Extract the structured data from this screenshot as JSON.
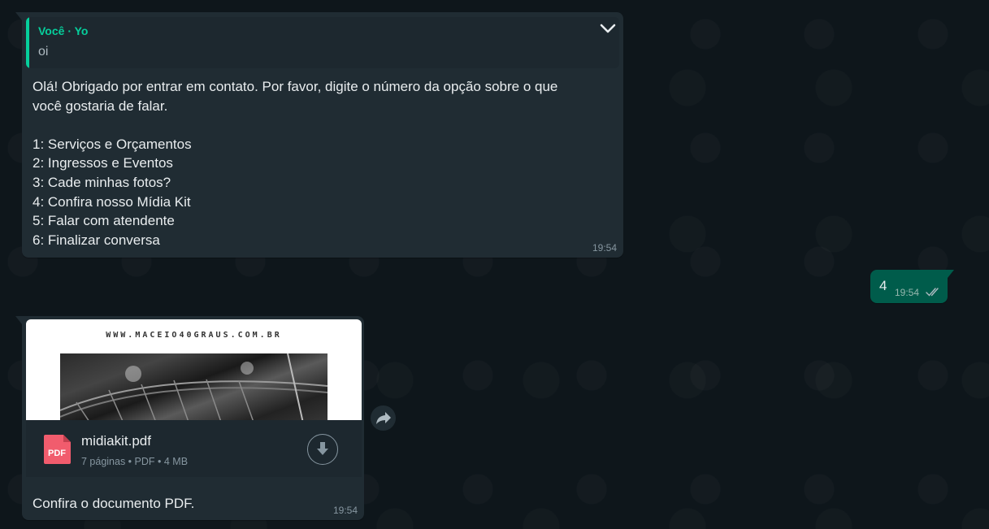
{
  "messages": {
    "greeting": {
      "quote_author": "Você · Yo",
      "quote_text": "oi",
      "body": "Olá! Obrigado por entrar em contato. Por favor, digite o número da opção sobre o que\nvocê gostaria de falar.\n\n1: Serviços e Orçamentos\n2: Ingressos e Eventos\n3: Cade minhas fotos?\n4: Confira nosso Mídia Kit\n5: Falar com atendente\n6: Finalizar conversa",
      "time": "19:54",
      "menu_icon": "chevron-down-icon"
    },
    "reply": {
      "text": "4",
      "time": "19:54",
      "status_icon": "double-check-icon"
    },
    "document": {
      "preview_url_text": "WWW.MACEIO40GRAUS.COM.BR",
      "file_name": "midiakit.pdf",
      "file_type_label": "PDF",
      "meta": "7 páginas • PDF • 4 MB",
      "caption": "Confira o documento PDF.",
      "time": "19:54",
      "download_icon": "download-icon",
      "forward_icon": "forward-icon"
    }
  },
  "colors": {
    "background": "#0b141a",
    "incoming_bubble": "#202c33",
    "outgoing_bubble": "#005c4b",
    "accent": "#06cf9c",
    "pdf_red": "#f15c6d",
    "meta_text": "#8696a0"
  }
}
